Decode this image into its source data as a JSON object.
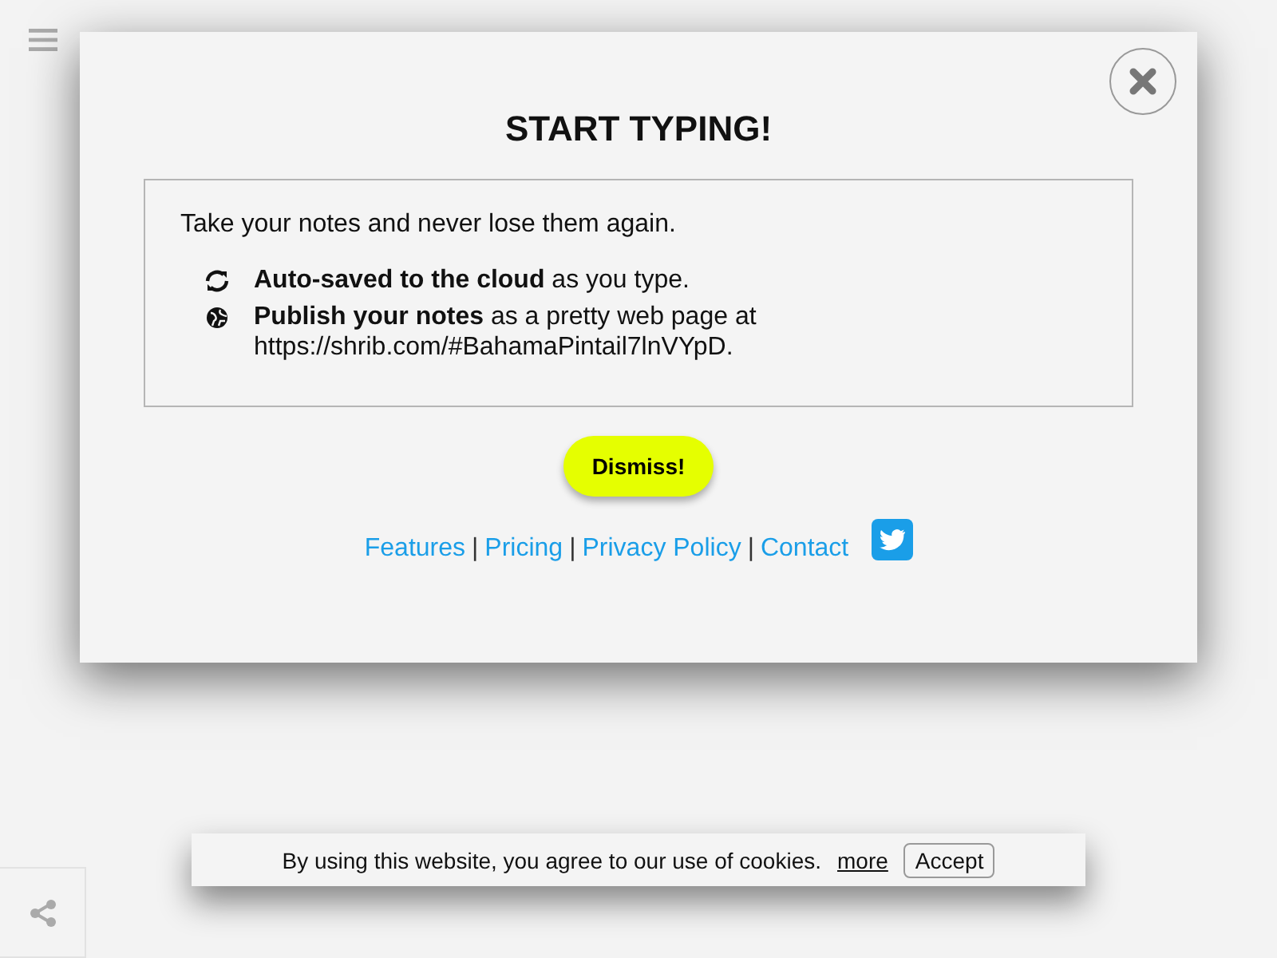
{
  "modal": {
    "title": "START TYPING!",
    "intro": "Take your notes and never lose them again.",
    "features": [
      {
        "kind": "sync",
        "text": "**Auto-saved to the cloud** as you type."
      },
      {
        "kind": "globe",
        "text": "**Publish your notes** as a pretty web page at https://shrib.com/#BahamaPintail7lnVYpD."
      }
    ],
    "dismiss": "Dismiss!",
    "links": [
      "Features",
      "Pricing",
      "Privacy Policy",
      "Contact"
    ],
    "separator": "|"
  },
  "cookie_bar": {
    "text": "By using this website, you agree to our use of cookies.",
    "link": "more",
    "button": "Accept"
  }
}
